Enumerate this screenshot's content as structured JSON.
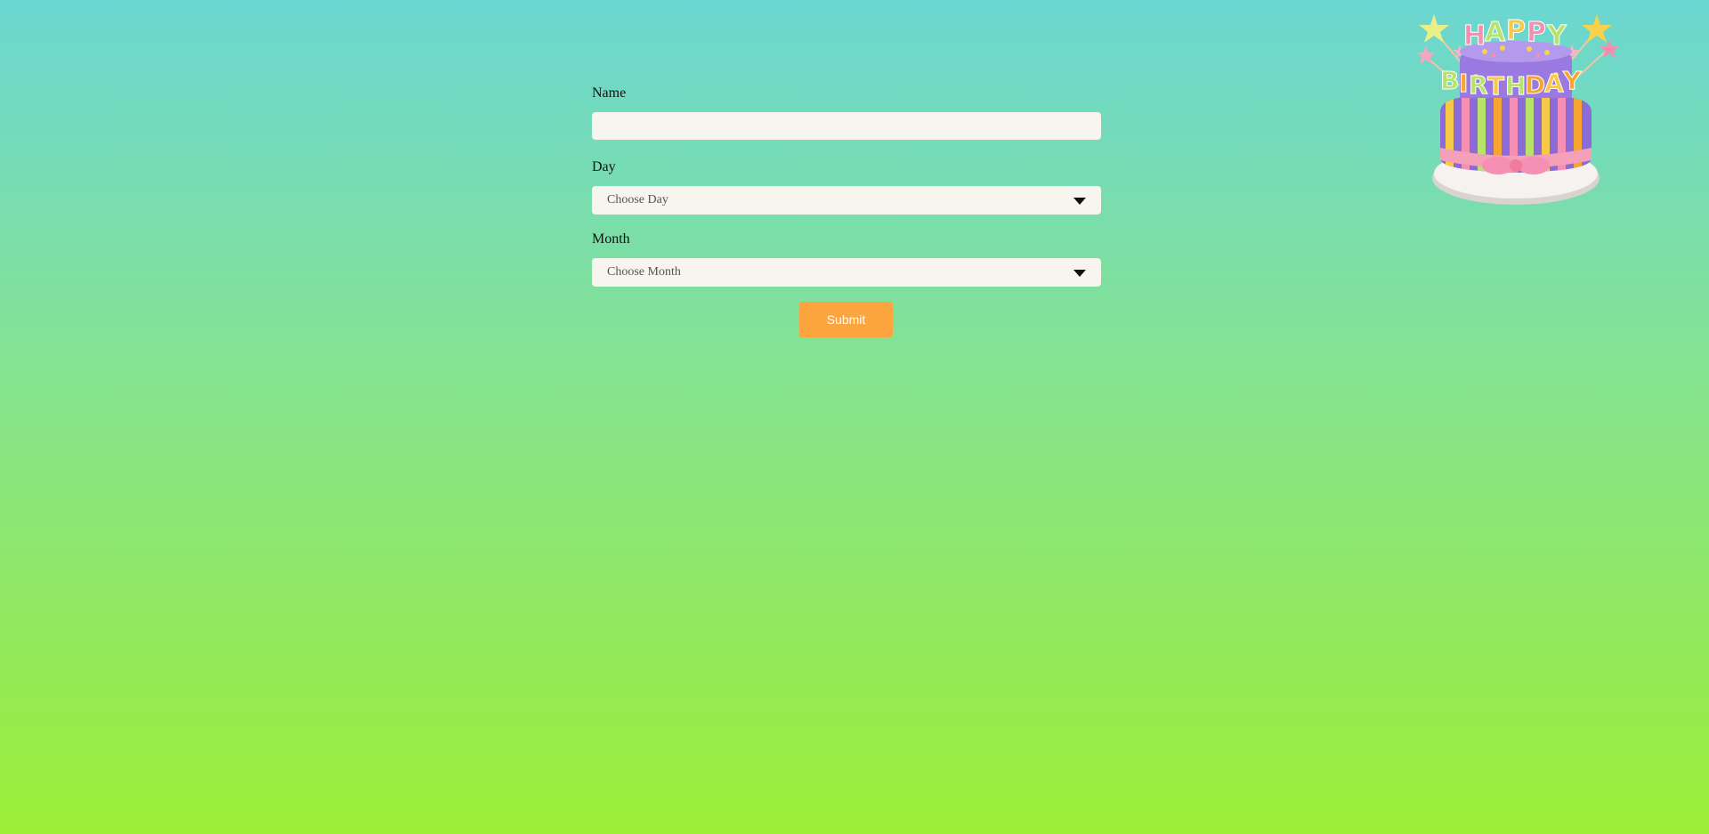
{
  "form": {
    "name_label": "Name",
    "name_value": "",
    "name_placeholder": "",
    "day_label": "Day",
    "day_selected": "Choose Day",
    "month_label": "Month",
    "month_selected": "Choose Month",
    "submit_label": "Submit"
  },
  "decoration": {
    "cake_icon": "birthday-cake-icon",
    "cake_text_top": "HAPPY",
    "cake_text_bottom": "BIRTHDAY"
  },
  "colors": {
    "background_top": "#6bd6d2",
    "background_bottom": "#9cee36",
    "field_background": "#f8f4ee",
    "submit_button": "#fca43e"
  }
}
